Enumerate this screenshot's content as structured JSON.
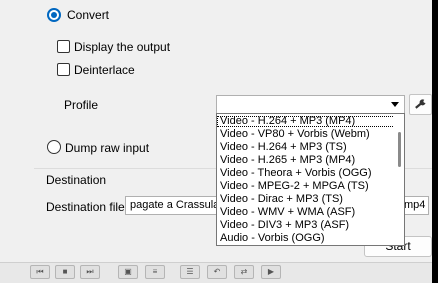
{
  "options": {
    "convert_label": "Convert",
    "display_output_label": "Display the output",
    "deinterlace_label": "Deinterlace",
    "profile_label": "Profile",
    "dump_raw_label": "Dump raw input"
  },
  "profile_dropdown": {
    "items": [
      "Video - H.264 + MP3 (MP4)",
      "Video - VP80 + Vorbis (Webm)",
      "Video - H.264 + MP3 (TS)",
      "Video - H.265 + MP3 (MP4)",
      "Video - Theora + Vorbis (OGG)",
      "Video - MPEG-2 + MPGA (TS)",
      "Video - Dirac + MP3 (TS)",
      "Video - WMV + WMA (ASF)",
      "Video - DIV3 + MP3 (ASF)",
      "Audio - Vorbis (OGG)"
    ]
  },
  "destination": {
    "group_title": "Destination",
    "file_label": "Destination file:",
    "file_value": "pagate a Crassula",
    "ext_value": "mp4"
  },
  "buttons": {
    "start_label": "Start"
  },
  "icons": {
    "wrench": "wrench-icon"
  }
}
